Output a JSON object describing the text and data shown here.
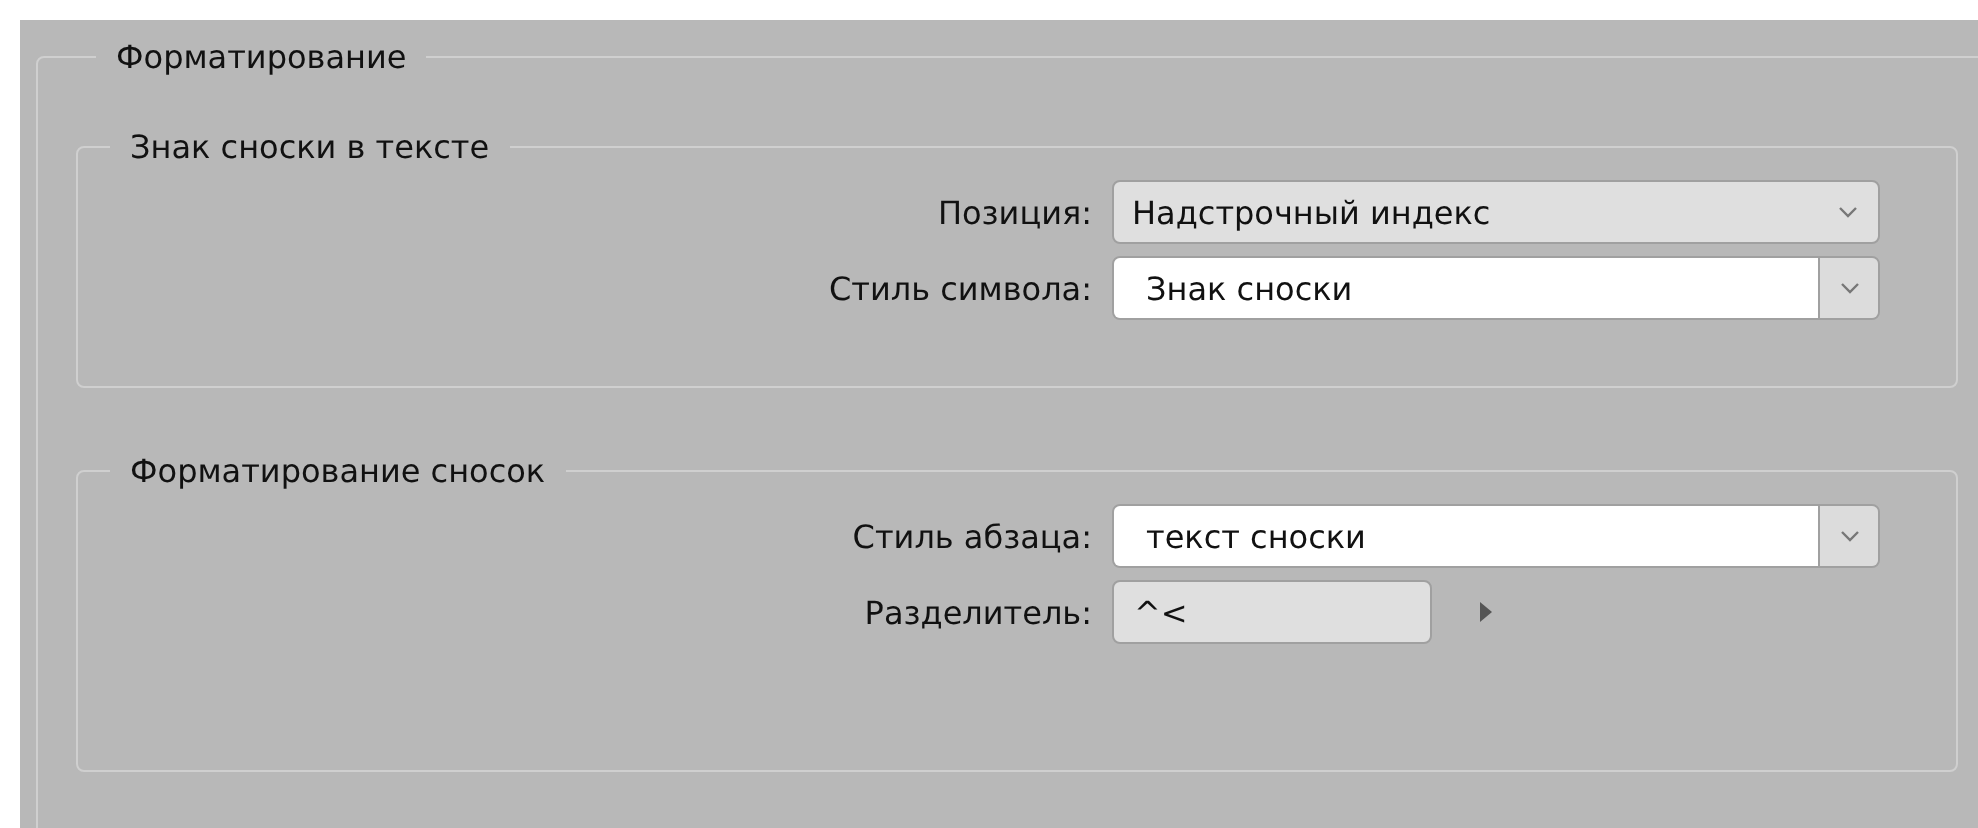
{
  "panel": {
    "title": "Форматирование"
  },
  "groups": [
    {
      "title": "Знак сноски в тексте",
      "rows": [
        {
          "kind": "select",
          "label": "Позиция:",
          "value": "Надстрочный индекс"
        },
        {
          "kind": "combo",
          "label": "Стиль символа:",
          "value": "Знак сноски"
        }
      ]
    },
    {
      "title": "Форматирование сносок",
      "rows": [
        {
          "kind": "combo",
          "label": "Стиль абзаца:",
          "value": "текст сноски"
        },
        {
          "kind": "text_menu",
          "label": "Разделитель:",
          "value": "^<"
        }
      ]
    }
  ]
}
